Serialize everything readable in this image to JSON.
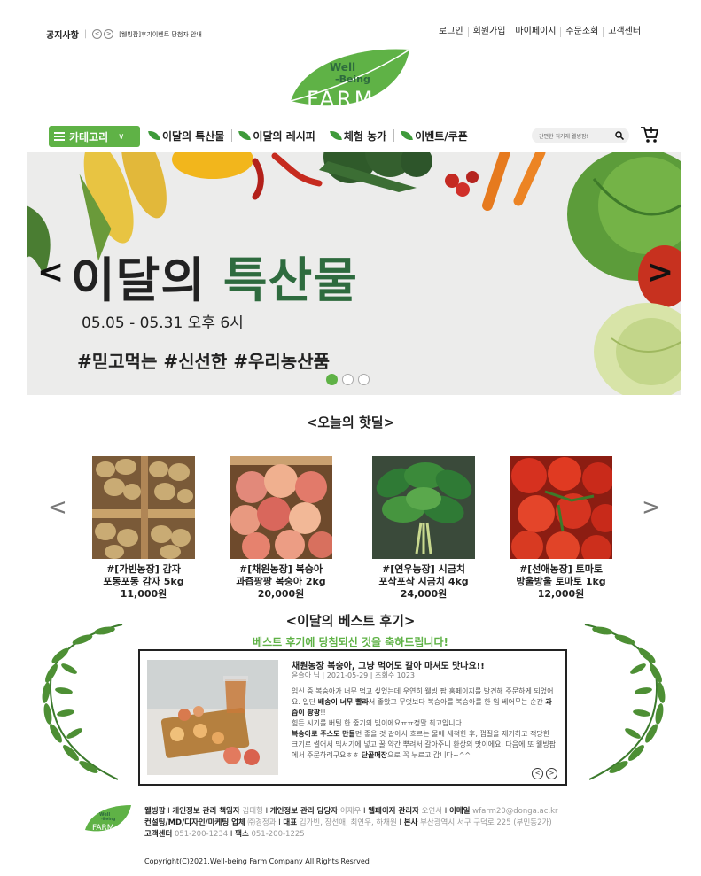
{
  "header": {
    "notice_label": "공지사항",
    "notice_prev": "<",
    "notice_next": ">",
    "notice_text": "[웰빙팜]후기이벤트 당첨자 안내",
    "util_links": [
      "로그인",
      "회원가입",
      "마이페이지",
      "주문조회",
      "고객센터"
    ]
  },
  "logo": {
    "line1": "Well",
    "line2": "-Being",
    "line3": "FARM"
  },
  "nav": {
    "category_label": "카테고리",
    "items": [
      "이달의 특산물",
      "이달의 레시피",
      "체험 농가",
      "이벤트/쿠폰"
    ],
    "search_placeholder": "간편한 직거래 웰빙팜!"
  },
  "banner": {
    "title_black": "이달의",
    "title_green": "특산물",
    "date": "05.05 - 05.31 오후 6시",
    "tags": "#믿고먹는 #신선한 #우리농산품",
    "prev": "<",
    "next": ">"
  },
  "hotdeal": {
    "heading": "<오늘의 핫딜>",
    "prev": "<",
    "next": ">",
    "products": [
      {
        "farm": "#[가빈농장] 감자",
        "name": "포동포동 감자 5kg",
        "price": "11,000원"
      },
      {
        "farm": "#[채원농장] 복숭아",
        "name": "과즙팡팡 복숭아 2kg",
        "price": "20,000원"
      },
      {
        "farm": "#[연우농장] 시금치",
        "name": "포삭포삭 시금치  4kg",
        "price": "24,000원"
      },
      {
        "farm": "#[선애농장] 토마토",
        "name": "방울방울 토마토 1kg",
        "price": "12,000원"
      }
    ]
  },
  "review": {
    "heading": "<이달의 베스트 후기>",
    "congrats": "베스트 후기에 당첨되신 것을 축하드립니다!",
    "title": "채원농장 복숭아, 그냥 먹어도 갈아 마셔도 맛나요!!",
    "meta": "윤슬아 님 | 2021-05-29 | 조회수 1023",
    "body_1": "임신 중 복숭아가 너무 먹고 싶었는데 우연히 웰빙 팜 홈페이지를 발견해 주문하게 되었어요. 일단 ",
    "body_1b": "배송이 너무 빨라",
    "body_1c": "서 좋았고 무엇보다 복숭아를 복숭아를 한 입 베어무는 순간 ",
    "body_1d": "과즙이 팡팡",
    "body_1e": "!!",
    "body_2": "힘든 시기를 버틸 한 줄기의 빛이에요ㅠㅠ정말 최고입니다!",
    "body_3b": "복숭아로 주스도 만들",
    "body_3": "면 좋을 것 같아서 흐르는 물에 세척한 후, 껍질을 제거하고 적당한 크기로 썰어서 믹서기에 넣고 꿀 약간 뿌려서 갈아주니 환상의 맛이에요. 다음에 또 웰빙팜에서 주문하려구요ㅎㅎ ",
    "body_3d": "단골매장",
    "body_3e": "으로 꼭 누르고 갑니다~^^",
    "prev": "<",
    "next": ">"
  },
  "footer": {
    "l1": [
      {
        "k": "웰빙팜",
        "v": ""
      },
      {
        "k": "개인정보 관리 책임자",
        "v": "김태형"
      },
      {
        "k": "개인정보 관리 담당자",
        "v": "이재우"
      },
      {
        "k": "웹페이지 관리자",
        "v": "오연서"
      },
      {
        "k": "이메일",
        "v": "wfarm20@donga.ac.kr"
      }
    ],
    "l2": [
      {
        "k": "컨설팅/MD/디자인/마케팅 업체",
        "v": "㈜경정과"
      },
      {
        "k": "대표",
        "v": "김가빈, 장선애, 최연우, 하채원"
      },
      {
        "k": "본사",
        "v": "부산광역시 서구 구덕로 225 (부민동2가)"
      }
    ],
    "l3": [
      {
        "k": "고객센터",
        "v": "051-200-1234"
      },
      {
        "k": "팩스",
        "v": "051-200-1225"
      }
    ],
    "copyright": "Copyright(C)2021.Well-being Farm Company All Rights Resrved"
  },
  "colors": {
    "brand_green": "#5fb246",
    "dark_green": "#2e6b3e"
  }
}
